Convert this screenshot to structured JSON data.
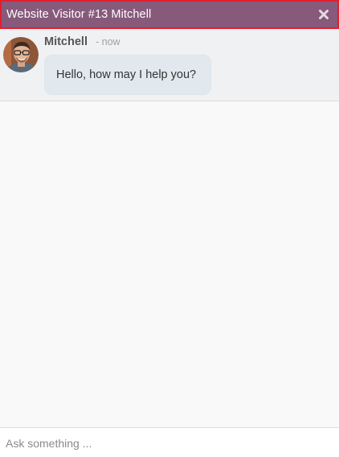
{
  "header": {
    "title": "Website Visitor #13 Mitchell",
    "close_icon": "close-icon",
    "background_color": "#875a7b",
    "border_color": "#e0202f"
  },
  "messages": [
    {
      "author": "Mitchell",
      "timestamp": "- now",
      "text": "Hello, how may I help you?",
      "avatar_icon": "user-avatar"
    }
  ],
  "composer": {
    "placeholder": "Ask something ..."
  }
}
